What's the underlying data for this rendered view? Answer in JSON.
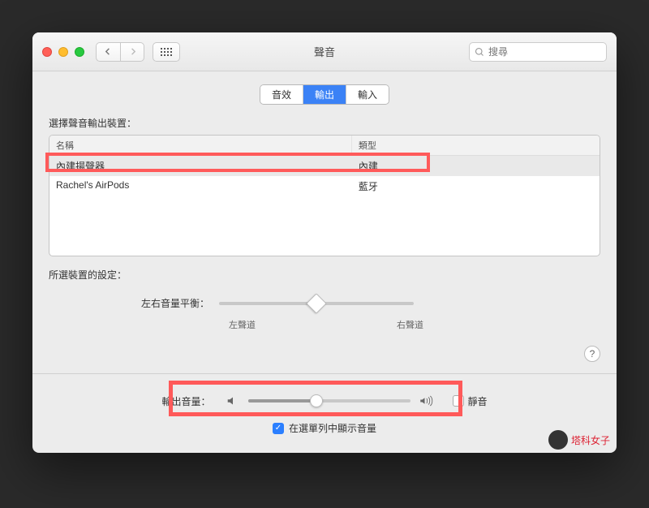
{
  "window": {
    "title": "聲音"
  },
  "toolbar": {
    "search_placeholder": "搜尋"
  },
  "tabs": [
    {
      "label": "音效",
      "active": false
    },
    {
      "label": "輸出",
      "active": true
    },
    {
      "label": "輸入",
      "active": false
    }
  ],
  "section": {
    "select_device_label": "選擇聲音輸出裝置：",
    "columns": {
      "name": "名稱",
      "type": "類型"
    },
    "devices": [
      {
        "name": "內建揚聲器",
        "type": "內建",
        "selected": true
      },
      {
        "name": "Rachel's AirPods",
        "type": "藍牙",
        "selected": false
      }
    ],
    "settings_label": "所選裝置的設定：",
    "balance": {
      "label": "左右音量平衡：",
      "left": "左聲道",
      "right": "右聲道",
      "value_percent": 50
    }
  },
  "output_volume": {
    "label": "輸出音量：",
    "value_percent": 42,
    "mute_label": "靜音",
    "mute_checked": false,
    "show_in_menubar_label": "在選單列中顯示音量",
    "show_in_menubar_checked": true
  },
  "help_tooltip": "?",
  "watermark": "塔科女子"
}
